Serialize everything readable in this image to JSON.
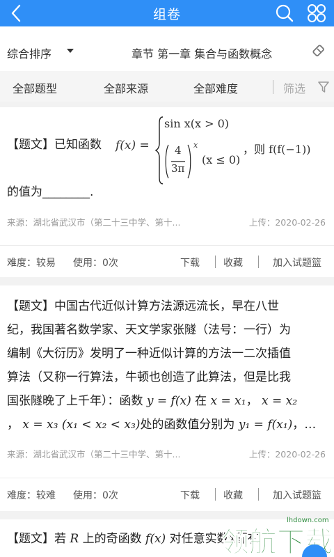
{
  "header": {
    "title": "组卷"
  },
  "sortbar": {
    "sort_label": "综合排序",
    "chapter": "章节 第一章 集合与函数概念"
  },
  "filters": {
    "type": "全部题型",
    "source": "全部来源",
    "difficulty": "全部难度",
    "screen": "筛选"
  },
  "questions": [
    {
      "tag": "【题文】",
      "text_before": "已知函数",
      "case1": "sin x(x > 0)",
      "case2_num": "4",
      "case2_den": "3π",
      "case2_cond": "(x ≤ 0)",
      "text_after": "，则 f(f(−1))",
      "text_line2": "的值为________.",
      "source": "来源：湖北省武汉市（第二十三中学、第十...",
      "upload": "上传：2020-02-26",
      "difficulty": "难度：较易",
      "usage": "使用：0次",
      "download": "下载",
      "favorite": "收藏",
      "add_basket": "加入试题篮"
    },
    {
      "tag": "【题文】",
      "line1": "中国古代近似计算方法源远流长，早在八世",
      "line2": "纪，我国著名数学家、天文学家张隧（法号：一行）为",
      "line3": "编制《大衍历》发明了一种近似计算的方法一二次插值",
      "line4": "算法（又称一行算法，牛顿也创造了此算法，但是比我",
      "line5_a": "国张隧晚了上千年）：函数",
      "line5_b": "y = f(x)",
      "line5_c": "在",
      "line5_d": "x = x₁",
      "line5_e": "，",
      "line5_f": "x = x₂",
      "line6_a": "，",
      "line6_b": "x = x₃ (x₁ < x₂ < x₃)",
      "line6_c": "处的函数值分别为",
      "line6_d": "y₁ = f(x₁)",
      "line6_e": "，…",
      "source": "来源：湖北省武汉市（第二十三中学、第十...",
      "upload": "上传：2020-02-26",
      "difficulty": "难度：较难",
      "usage": "使用：0次",
      "download": "下载",
      "favorite": "收藏",
      "add_basket": "加入试题篮"
    },
    {
      "tag": "【题文】",
      "text_a": "若",
      "text_b": "R",
      "text_c": "上的奇函数",
      "text_d": "f(x)",
      "text_e": "对任意实数x都有"
    }
  ],
  "watermark": {
    "brand": "领航下载",
    "site": "lhdown.com"
  },
  "colors": {
    "primary": "#2f8ff7",
    "watermark": "#2e8b3e"
  }
}
